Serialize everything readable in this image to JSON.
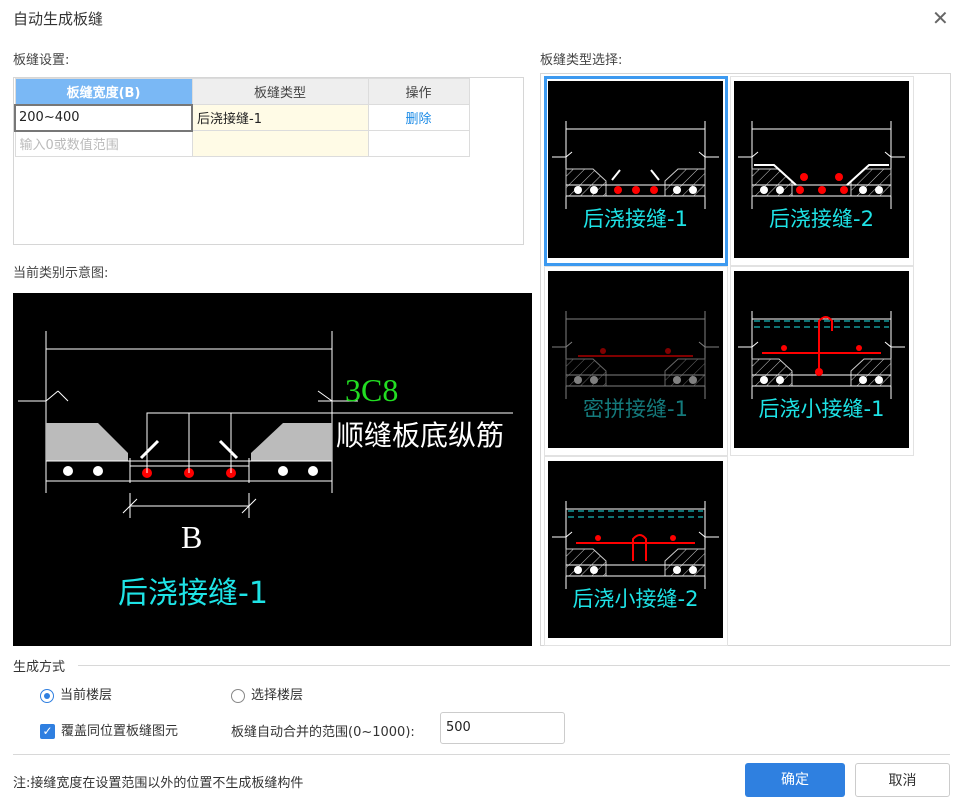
{
  "dialog": {
    "title": "自动生成板缝",
    "close_icon": "close-icon"
  },
  "settings": {
    "label": "板缝设置:",
    "columns": [
      "板缝宽度(B)",
      "板缝类型",
      "操作"
    ],
    "rows": [
      {
        "width": "200~400",
        "type": "后浇接缝-1",
        "action": "删除"
      }
    ],
    "new_row_placeholder": "输入0或数值范围"
  },
  "preview": {
    "label": "当前类别示意图:",
    "rebar_count": "3C8",
    "rebar_desc": "顺缝板底纵筋",
    "dim": "B",
    "name": "后浇接缝-1"
  },
  "type_select": {
    "label": "板缝类型选择:",
    "items": [
      {
        "label": "后浇接缝-1",
        "selected": true
      },
      {
        "label": "后浇接缝-2"
      },
      {
        "label": "密拼接缝-1"
      },
      {
        "label": "后浇小接缝-1"
      },
      {
        "label": "后浇小接缝-2"
      }
    ]
  },
  "generate": {
    "label": "生成方式",
    "radio_current": "当前楼层",
    "radio_select": "选择楼层",
    "selected": "当前楼层",
    "override_label": "覆盖同位置板缝图元",
    "override_checked": true,
    "merge_label": "板缝自动合并的范围(0~1000):",
    "merge_value": "500"
  },
  "note": "注:接缝宽度在设置范围以外的位置不生成板缝构件",
  "buttons": {
    "ok": "确定",
    "cancel": "取消"
  },
  "colors": {
    "accent": "#2f80e0",
    "cyan": "#1ee3e6",
    "rebar": "#ff0000",
    "green": "#22dd22"
  }
}
